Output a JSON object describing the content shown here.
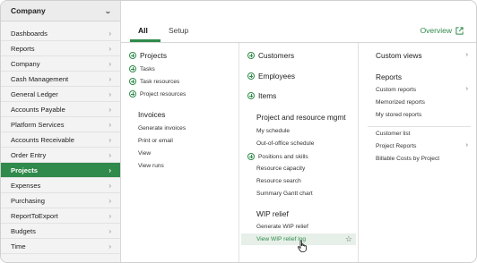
{
  "sidebar": {
    "header": "Company",
    "items": [
      {
        "label": "Dashboards"
      },
      {
        "label": "Reports"
      },
      {
        "label": "Company"
      },
      {
        "label": "Cash Management"
      },
      {
        "label": "General Ledger"
      },
      {
        "label": "Accounts Payable"
      },
      {
        "label": "Platform Services"
      },
      {
        "label": "Accounts Receivable"
      },
      {
        "label": "Order Entry"
      },
      {
        "label": "Projects",
        "active": true
      },
      {
        "label": "Expenses"
      },
      {
        "label": "Purchasing"
      },
      {
        "label": "ReportToExport"
      },
      {
        "label": "Budgets"
      },
      {
        "label": "Time"
      }
    ]
  },
  "tabs": {
    "all": "All",
    "setup": "Setup",
    "overview": "Overview"
  },
  "col1": {
    "projects_head": "Projects",
    "items": [
      "Tasks",
      "Task resources",
      "Project resources"
    ],
    "invoices_head": "Invoices",
    "invoice_items": [
      "Generate invoices",
      "Print or email",
      "View",
      "View runs"
    ]
  },
  "col2": {
    "customers": "Customers",
    "employees": "Employees",
    "items_head": "Items",
    "prm_head": "Project and resource mgmt",
    "prm_items": [
      "My schedule",
      "Out-of-office schedule",
      "Positions and skills",
      "Resource capacity",
      "Resource search",
      "Summary Gantt chart"
    ],
    "wip_head": "WIP relief",
    "wip_items": [
      "Generate WIP relief",
      "View WIP relief log"
    ]
  },
  "col3": {
    "custom_views": "Custom views",
    "reports_head": "Reports",
    "report_items": [
      "Custom reports",
      "Memorized reports",
      "My stored reports"
    ],
    "other_items": [
      "Customer list",
      "Project Reports",
      "Billable Costs by Project"
    ]
  },
  "colors": {
    "accent": "#2f8a4b"
  }
}
